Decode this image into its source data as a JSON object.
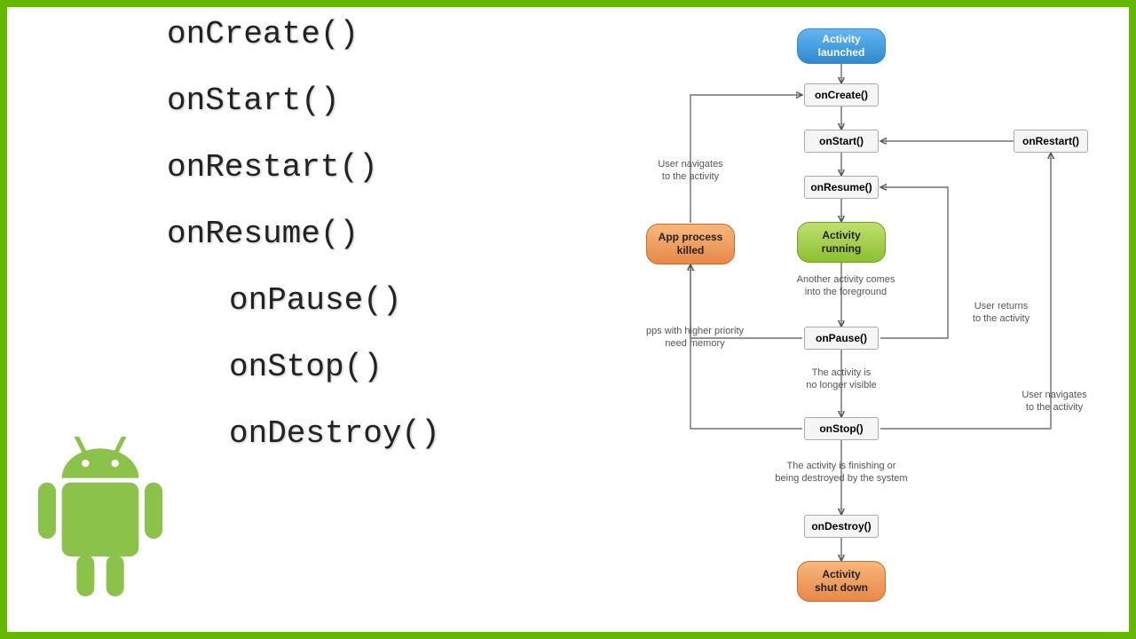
{
  "colors": {
    "frame": "#65b800",
    "android": "#8bc34a",
    "blue0": "#62b6f0",
    "blue1": "#2f8ad0",
    "green0": "#c0e070",
    "green1": "#8bbf30",
    "orange0": "#f8b77a",
    "orange1": "#e7884a"
  },
  "methods": [
    "onCreate()",
    "onStart()",
    "onRestart()",
    "onResume()",
    "onPause()",
    "onStop()",
    "onDestroy()"
  ],
  "indentedFrom": 4,
  "nodes": {
    "launched": "Activity\nlaunched",
    "oncreate": "onCreate()",
    "onstart": "onStart()",
    "onrestart": "onRestart()",
    "onresume": "onResume()",
    "running": "Activity\nrunning",
    "onpause": "onPause()",
    "onstop": "onStop()",
    "ondestroy": "onDestroy()",
    "killed": "App process\nkilled",
    "shutdown": "Activity\nshut down"
  },
  "labels": {
    "userNavigates": "User navigates\nto the activity",
    "anotherActivity": "Another activity comes\ninto the foreground",
    "higherPriority": "pps with higher priority\nneed memory",
    "userReturns": "User returns\nto the activity",
    "noLongerVisible": "The activity is\nno longer visible",
    "userNavigates2": "User navigates\nto the activity",
    "finishing": "The activity is finishing or\nbeing destroyed by the system"
  }
}
